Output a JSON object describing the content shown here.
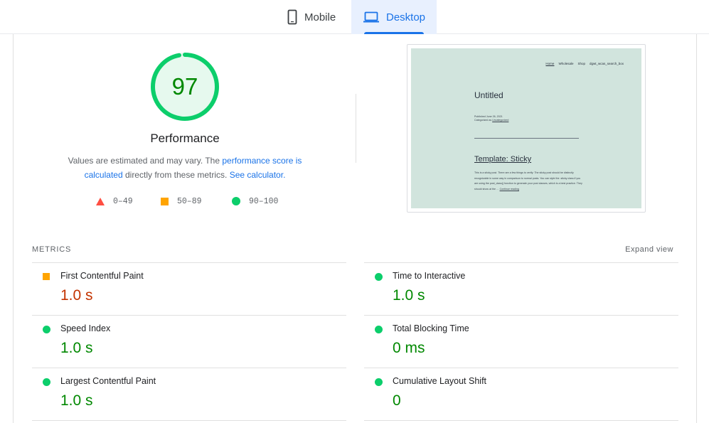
{
  "tabs": [
    {
      "label": "Mobile",
      "icon": "phone-icon",
      "active": false
    },
    {
      "label": "Desktop",
      "icon": "laptop-icon",
      "active": true
    }
  ],
  "gauge": {
    "score": "97",
    "score_fraction": 0.97,
    "color": "#0cce6b",
    "title": "Performance"
  },
  "description": {
    "text1": "Values are estimated and may vary. The ",
    "link1": "performance score is calculated",
    "text2": " directly from these metrics. ",
    "link2": "See calculator."
  },
  "legend": [
    {
      "shape": "triangle-icon",
      "range": "0–49",
      "color": "#ff4e42"
    },
    {
      "shape": "square-icon",
      "range": "50–89",
      "color": "#ffa400"
    },
    {
      "shape": "circle-icon",
      "range": "90–100",
      "color": "#0cce6b"
    }
  ],
  "screenshot": {
    "nav": [
      "Home",
      "Wholesale",
      "Shop",
      "dgwt_wcas_search_box"
    ],
    "post1_title": "Untitled",
    "post1_meta_line1": "Published June 26, 2021",
    "post1_meta_prefix": "Categorized as ",
    "post1_meta_link": "Uncategorized",
    "post2_title": "Template: Sticky",
    "post2_body": "This is a sticky post. There are a few things to verify: The sticky post should be distinctly recognizable in some way in comparison to normal posts. You can style the .sticky class if you are using the post_class() function to generate your post classes, which is a best practice. They should show at the … ",
    "post2_link": "Continue reading"
  },
  "metrics": {
    "heading": "METRICS",
    "expand_label": "Expand view",
    "items": [
      {
        "label": "First Contentful Paint",
        "value": "1.0 s",
        "status": "average"
      },
      {
        "label": "Time to Interactive",
        "value": "1.0 s",
        "status": "pass"
      },
      {
        "label": "Speed Index",
        "value": "1.0 s",
        "status": "pass"
      },
      {
        "label": "Total Blocking Time",
        "value": "0 ms",
        "status": "pass"
      },
      {
        "label": "Largest Contentful Paint",
        "value": "1.0 s",
        "status": "pass"
      },
      {
        "label": "Cumulative Layout Shift",
        "value": "0",
        "status": "pass"
      }
    ]
  },
  "colors": {
    "pass": "#0cce6b",
    "average": "#ffa400",
    "fail": "#ff4e42",
    "pass_text": "#008800",
    "average_text": "#c33300",
    "accent": "#1a73e8"
  }
}
